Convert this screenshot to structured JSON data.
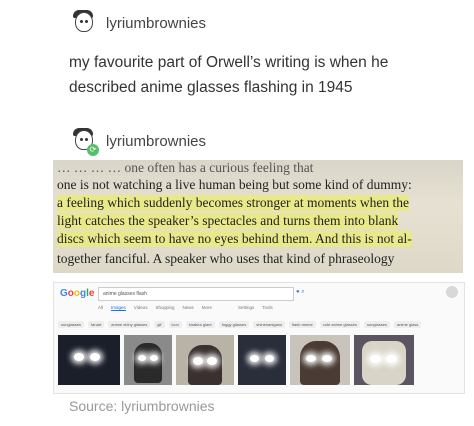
{
  "post": {
    "author": "lyriumbrownies",
    "text": "my favourite part of Orwell’s writing is when he described anime glasses flashing in 1945"
  },
  "reblog": {
    "author": "lyriumbrownies"
  },
  "book_text": {
    "line1": "… … … … one often has a curious feeling that",
    "line2": "one is not watching a live human being but some kind of dummy:",
    "line3": "a feeling which suddenly becomes stronger at moments when the",
    "line4": "light catches the speaker’s spectacles and turns them into blank",
    "line5": "discs which seem to have no eyes behind them. And this is not al-",
    "line6": "together fanciful. A speaker who uses that kind of phraseology"
  },
  "google": {
    "logo": "Google",
    "query": "anime glasses flash",
    "tabs": [
      "All",
      "Images",
      "Videos",
      "Shopping",
      "News",
      "More",
      "Settings",
      "Tools"
    ],
    "chips": [
      "sunglasses",
      "fanart",
      "anime shiny glasses",
      "gif",
      "icon",
      "kirakira glare",
      "foggy glasses",
      "shinenanigans",
      "flash meme",
      "cute anime glasses",
      "sunglasses",
      "anime glass",
      "glint"
    ],
    "thumb_count": 6,
    "colors": {
      "blue": "#4285F4",
      "red": "#EA4335",
      "yellow": "#FBBC05",
      "green": "#34A853"
    }
  },
  "source": "Source: lyriumbrownies",
  "colors": {
    "reblog_badge": "#5bbf6a",
    "highlight": "#e9e98a"
  }
}
